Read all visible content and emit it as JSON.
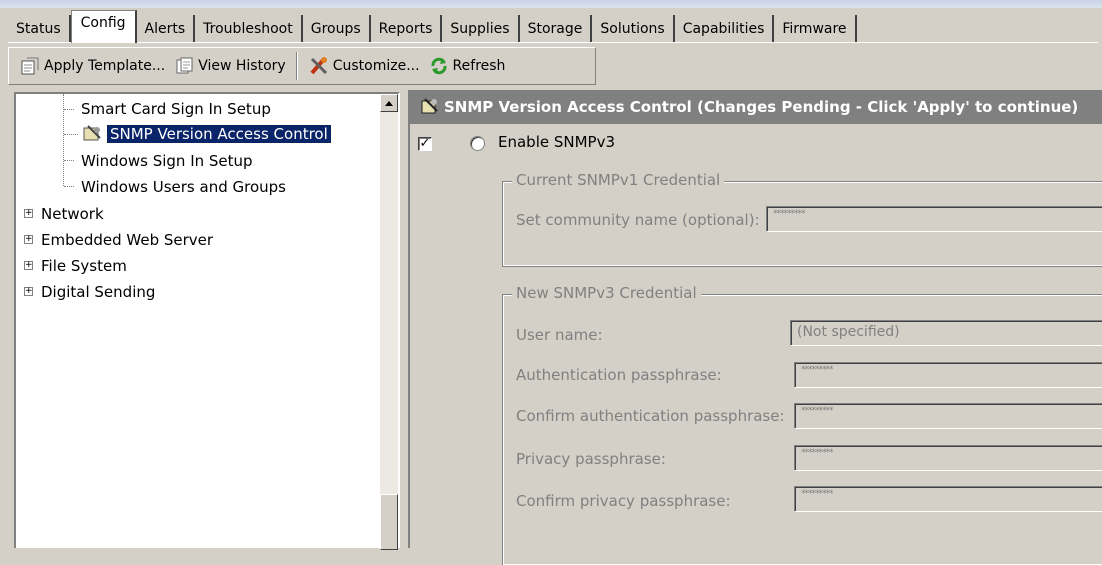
{
  "tabs": [
    "Status",
    "Config",
    "Alerts",
    "Troubleshoot",
    "Groups",
    "Reports",
    "Supplies",
    "Storage",
    "Solutions",
    "Capabilities",
    "Firmware"
  ],
  "active_tab": "Config",
  "toolbar": {
    "apply_template": "Apply Template...",
    "view_history": "View History",
    "customize": "Customize...",
    "refresh": "Refresh"
  },
  "tree": {
    "smart_card": "Smart Card Sign In Setup",
    "snmp": "SNMP Version Access Control",
    "windows_sign_in": "Windows Sign In Setup",
    "windows_users": "Windows Users and Groups",
    "network": "Network",
    "ews": "Embedded Web Server",
    "file_system": "File System",
    "digital_sending": "Digital Sending"
  },
  "panel": {
    "header": "SNMP Version Access Control  (Changes Pending - Click 'Apply' to continue)",
    "enable_snmpv3": "Enable SNMPv3",
    "current_group": "Current SNMPv1 Credential",
    "community_label": "Set community name (optional):",
    "community_value": "*********",
    "new_group": "New SNMPv3 Credential",
    "user_name_label": "User name:",
    "user_name_value": "(Not specified)",
    "auth_label": "Authentication passphrase:",
    "auth_value": "*********",
    "confirm_auth_label": "Confirm authentication passphrase:",
    "confirm_auth_value": "*********",
    "privacy_label": "Privacy passphrase:",
    "privacy_value": "*********",
    "confirm_privacy_label": "Confirm privacy passphrase:",
    "confirm_privacy_value": "*********"
  }
}
